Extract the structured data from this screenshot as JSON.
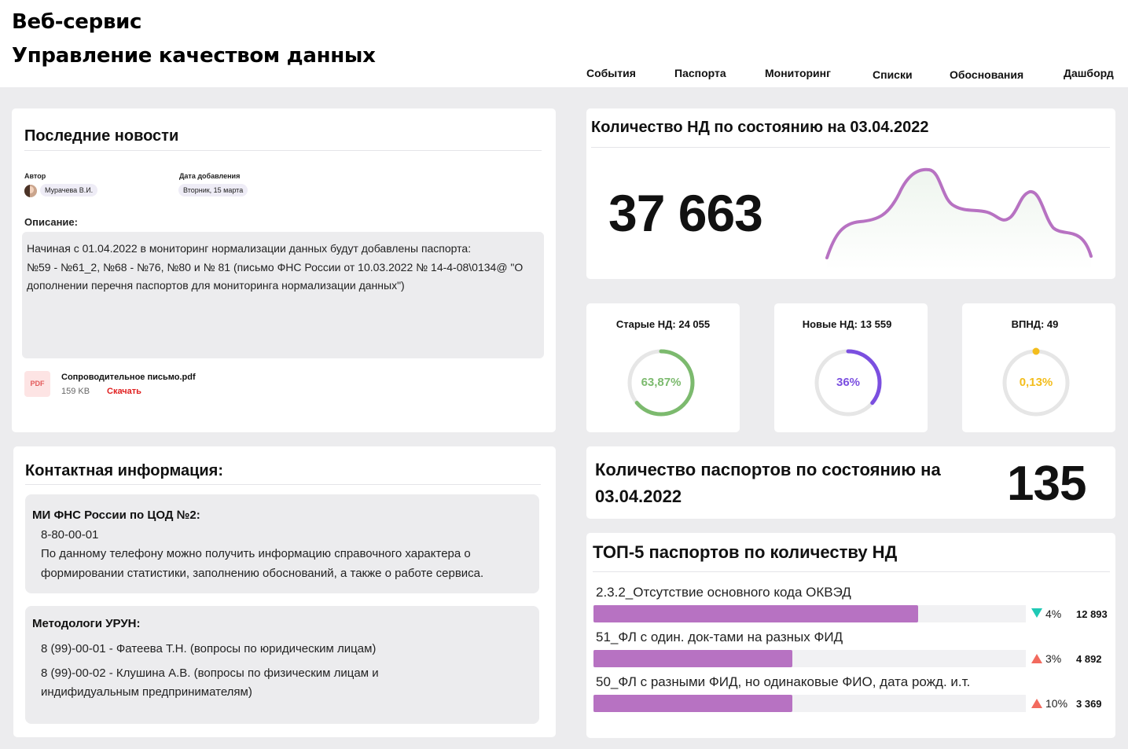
{
  "app": {
    "title_line1": "Веб-сервис",
    "title_line2": "Управление качеством данных"
  },
  "nav": {
    "items": [
      "События",
      "Паспорта",
      "Мониторинг",
      "Списки",
      "Обоснования",
      "Дашборд"
    ]
  },
  "news": {
    "title": "Последние новости",
    "author_label": "Автор",
    "author_name": "Мурачева В.И.",
    "date_label": "Дата добавления",
    "date_value": "Вторник, 15 марта",
    "description_label": "Описание:",
    "description_lines": [
      "Начиная с 01.04.2022 в мониторинг нормализации данных будут добавлены паспорта:",
      "№59 - №61_2, №68 - №76, №80 и № 81 (письмо ФНС России от 10.03.2022 № 14-4-08\\0134@ \"О",
      "дополнении перечня паспортов для мониторинга нормализации данных\")"
    ],
    "attachment": {
      "icon_text": "PDF",
      "name": "Сопроводительное письмо.pdf",
      "size": "159 KB",
      "download_label": "Скачать"
    }
  },
  "contacts": {
    "title": "Контактная информация:",
    "block1": {
      "heading": "МИ ФНС России по ЦОД №2:",
      "phone": "8-80-00-01",
      "note_lines": [
        "По данному телефону можно получить информацию справочного характера о",
        "формировании статистики, заполнению обоснований, а также о работе сервиса."
      ]
    },
    "block2": {
      "heading": "Методологи УРУН:",
      "lines": [
        "8 (99)-00-01 - Фатеева Т.Н. (вопросы по юридическим лицам)",
        "8 (99)-00-02 - Клушина А.В. (вопросы по физическим лицам и",
        "индифидуальным предпринимателям)"
      ]
    }
  },
  "nd_count": {
    "title": "Количество НД по состоянию на 03.04.2022",
    "value": "37 663",
    "sparkline_color": "#b772c2"
  },
  "stats": [
    {
      "label": "Старые НД: 24 055",
      "percent_text": "63,87%",
      "fraction": 0.6387,
      "color": "#7cba6e"
    },
    {
      "label": "Новые НД: 13 559",
      "percent_text": "36%",
      "fraction": 0.36,
      "color": "#7b4fe0"
    },
    {
      "label": "ВПНД: 49",
      "percent_text": "0,13%",
      "fraction": 0.0013,
      "color": "#f3bd1c"
    }
  ],
  "passports": {
    "title_line1": "Количество паспортов по состоянию на",
    "title_line2": "03.04.2022",
    "value": "135"
  },
  "top5": {
    "title": "ТОП-5 паспортов по количеству НД",
    "bar_color": "#b772c2",
    "items": [
      {
        "label": "2.3.2_Отсутствие основного кода ОКВЭД",
        "fraction": 0.75,
        "trend": "down",
        "percent": "4%",
        "count": "12 893"
      },
      {
        "label": "51_ФЛ с один. док-тами на разных ФИД",
        "fraction": 0.46,
        "trend": "up",
        "percent": "3%",
        "count": "4 892"
      },
      {
        "label": "50_ФЛ с разными ФИД, но одинаковые ФИО, дата рожд. и.т.",
        "fraction": 0.46,
        "trend": "up",
        "percent": "10%",
        "count": "3 369"
      }
    ]
  }
}
